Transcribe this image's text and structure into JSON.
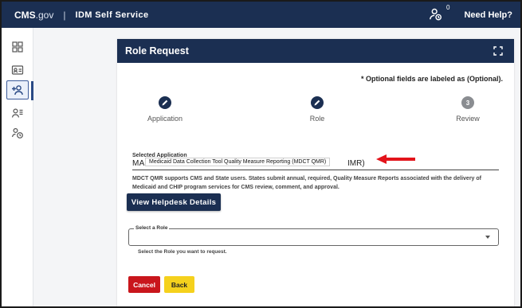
{
  "topbar": {
    "brand_cms": "CMS",
    "brand_gov": ".gov",
    "separator": "|",
    "app_name": "IDM Self Service",
    "notification_count": "0",
    "help_label": "Need Help?"
  },
  "rail": {
    "items": [
      {
        "icon": "grid-icon",
        "active": false
      },
      {
        "icon": "id-card-icon",
        "active": false
      },
      {
        "icon": "add-user-icon",
        "active": true
      },
      {
        "icon": "user-list-icon",
        "active": false
      },
      {
        "icon": "user-history-icon",
        "active": false
      }
    ]
  },
  "card": {
    "title": "Role Request",
    "optional_note": "* Optional fields are labeled as (Optional).",
    "steps": [
      {
        "label": "Application",
        "state": "complete",
        "number": ""
      },
      {
        "label": "Role",
        "state": "complete",
        "number": ""
      },
      {
        "label": "Review",
        "state": "pending",
        "number": "3"
      }
    ],
    "selected_application": {
      "label": "Selected Application",
      "value_prefix": "MAC",
      "value_suffix": "IMR)",
      "overlay_text": "Medicaid Data Collection Tool Quality Measure Reporting (MDCT QMR)"
    },
    "description": "MDCT QMR supports CMS and State users. States submit annual, required, Quality Measure Reports associated with the delivery of Medicaid and CHIP program services for CMS review, comment, and approval.",
    "helpdesk_button": "View Helpdesk Details",
    "role_select": {
      "legend": "Select a Role",
      "value": "",
      "help": "Select the Role you want to request."
    },
    "cancel_button": "Cancel",
    "back_button": "Back"
  },
  "colors": {
    "navy": "#1b2f52",
    "danger": "#c9161c",
    "warning": "#f5d11d",
    "annotation_arrow": "#e3141b"
  }
}
